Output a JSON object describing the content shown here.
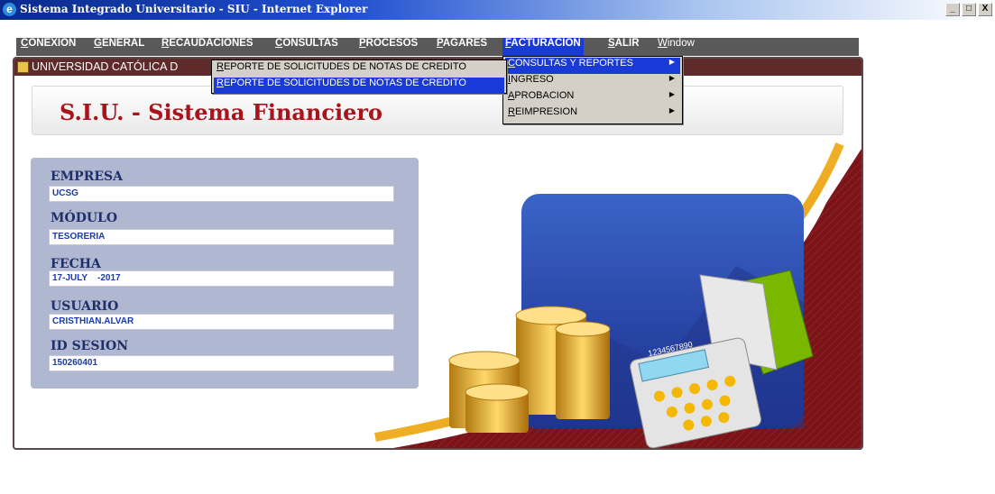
{
  "window": {
    "title": "Sistema Integrado Universitario - SIU - Internet Explorer",
    "app_icon": "ie-icon",
    "controls": [
      "_",
      "□",
      "X"
    ]
  },
  "menubar": {
    "items": [
      {
        "label": "CONEXION",
        "underline": "C",
        "rest": "ONEXION"
      },
      {
        "label": "GENERAL",
        "underline": "G",
        "rest": "ENERAL"
      },
      {
        "label": "RECAUDACIONES",
        "underline": "R",
        "rest": "ECAUDACIONES"
      },
      {
        "label": "CONSULTAS",
        "underline": "C",
        "rest": "ONSULTAS"
      },
      {
        "label": "PROCESOS",
        "underline": "P",
        "rest": "ROCESOS"
      },
      {
        "label": "PAGARES",
        "underline": "P",
        "rest": "AGARES"
      },
      {
        "label": "FACTURACION",
        "underline": "F",
        "rest": "ACTURACION"
      },
      {
        "label": "SALIR",
        "underline": "S",
        "rest": "ALIR"
      },
      {
        "label": "Window",
        "underline": "W",
        "rest": "indow"
      }
    ],
    "active": "FACTURACION"
  },
  "frame": {
    "title": "UNIVERSIDAD CATÓLICA DE SANTIAGO DE GUAYAQUIL",
    "visible_title": "UNIVERSIDAD CATÓLICA D"
  },
  "header": {
    "title": "S.I.U. - Sistema Financiero"
  },
  "info": {
    "empresa_label": "EMPRESA",
    "empresa_value": "UCSG",
    "modulo_label": "MÓDULO",
    "modulo_value": "TESORERIA",
    "fecha_label": "FECHA",
    "fecha_value": "17-JULY    -2017",
    "usuario_label": "USUARIO",
    "usuario_value": "CRISTHIAN.ALVAR",
    "sesion_label": "ID SESION",
    "sesion_value": "150260401"
  },
  "facturacion_menu": {
    "items": [
      {
        "underline": "C",
        "rest": "ONSULTAS Y REPORTES",
        "submenu": true
      },
      {
        "underline": "I",
        "rest": "NGRESO",
        "submenu": true
      },
      {
        "underline": "A",
        "rest": "PROBACION",
        "submenu": true
      },
      {
        "underline": "R",
        "rest": "EIMPRESION",
        "submenu": true
      }
    ]
  },
  "consultas_submenu": {
    "items": [
      {
        "underline": "R",
        "rest": "EPORTE DE SOLICITUDES DE NOTAS DE CREDITO"
      },
      {
        "underline": "R",
        "rest": "EPORTE  DE SOLICITUDES DE NOTAS DE CREDITO"
      }
    ]
  },
  "calculator_display": "1234567890",
  "colors": {
    "menu_bg": "#595959",
    "highlight": "#1a3ad8",
    "brand_red": "#a8141c",
    "maroon": "#7a1418",
    "gold": "#f5a800",
    "panel": "#b0b7d0"
  }
}
